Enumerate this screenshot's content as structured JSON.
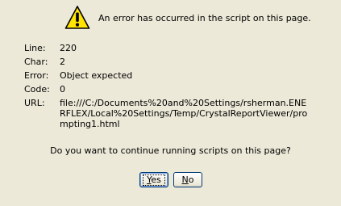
{
  "dialog": {
    "headline": "An error has occurred in the script on this page.",
    "icon": "warning-icon"
  },
  "details": [
    {
      "label": "Line:",
      "value": "220"
    },
    {
      "label": "Char:",
      "value": "2"
    },
    {
      "label": "Error:",
      "value": "Object expected"
    },
    {
      "label": "Code:",
      "value": "0"
    },
    {
      "label": "URL:",
      "value": "file:///C:/Documents%20and%20Settings/rsherman.ENERFLEX/Local%20Settings/Temp/CrystalReportViewer/prompting1.html"
    }
  ],
  "question": "Do you want to continue running scripts on this page?",
  "buttons": {
    "yes": {
      "mnemonic": "Y",
      "rest": "es"
    },
    "no": {
      "mnemonic": "N",
      "rest": "o"
    }
  },
  "colors": {
    "warning_fill": "#ffe400",
    "dialog_bg": "#ece9d8",
    "button_border": "#003c74"
  }
}
